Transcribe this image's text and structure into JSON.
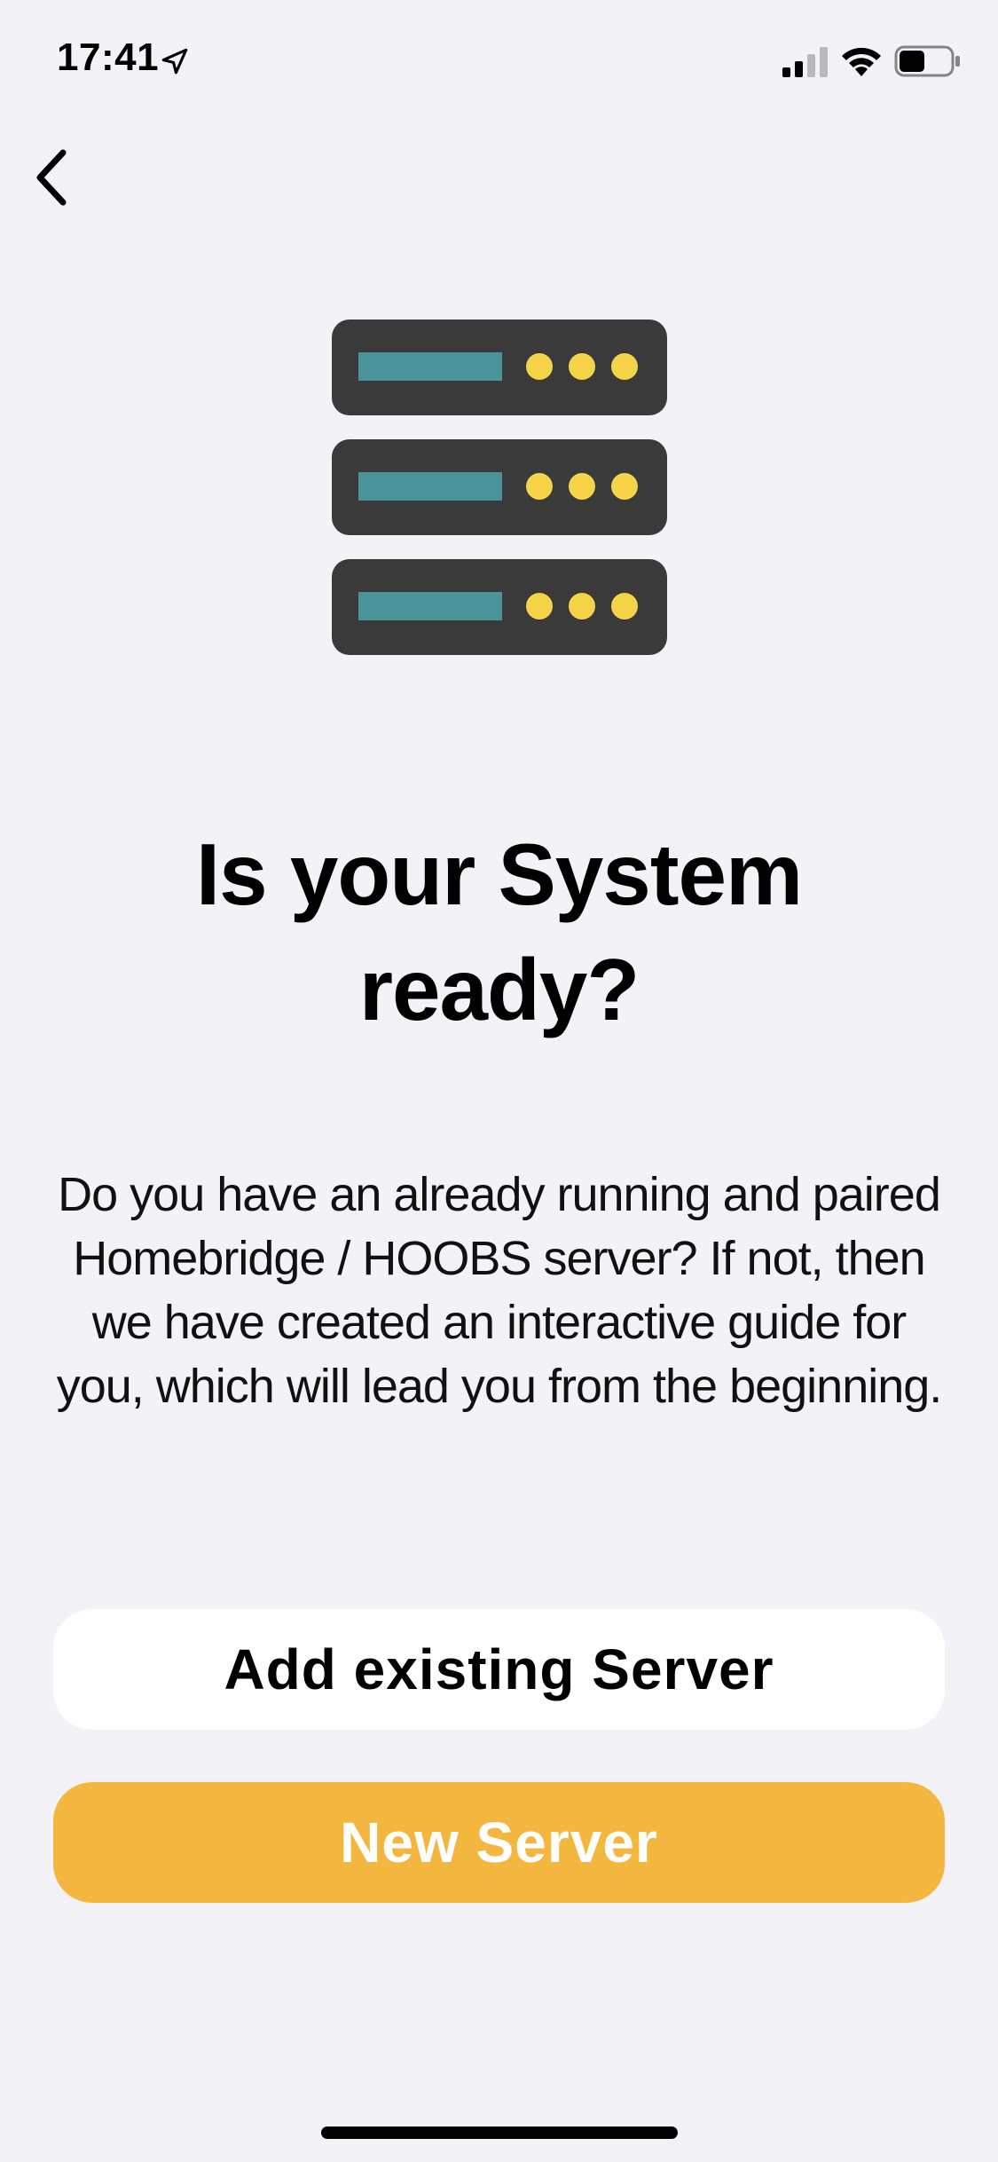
{
  "status_bar": {
    "time": "17:41",
    "location_icon": "location-arrow-icon",
    "signal_icon": "cellular-signal-icon",
    "wifi_icon": "wifi-icon",
    "battery_icon": "battery-icon",
    "signal_bars_active": 2,
    "signal_bars_total": 4,
    "battery_level": 0.5
  },
  "nav": {
    "back_icon": "chevron-left-icon"
  },
  "illustration": {
    "icon": "server-rack-icon",
    "colors": {
      "unit": "#3a3a3a",
      "slot": "#4a9499",
      "light": "#f5d547"
    }
  },
  "content": {
    "title": "Is your System ready?",
    "description": "Do you have an already running and paired Homebridge / HOOBS server? If not, then we have created an interactive guide for you, which will lead you from the beginning."
  },
  "actions": {
    "add_existing_label": "Add existing Server",
    "new_server_label": "New Server"
  },
  "colors": {
    "background": "#f2f2f7",
    "accent": "#f3b740",
    "secondary_button": "#ffffff"
  }
}
